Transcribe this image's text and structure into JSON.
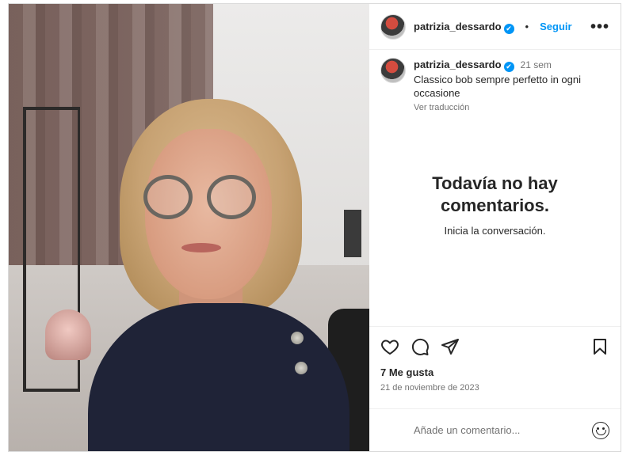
{
  "post": {
    "username": "patrizia_dessardo",
    "verified_symbol": "✔",
    "separator": "•",
    "follow_label": "Seguir",
    "more_label": "•••",
    "caption": {
      "username": "patrizia_dessardo",
      "time": "21 sem",
      "text": "Classico bob sempre perfetto in ogni occasione",
      "translate_label": "Ver traducción"
    },
    "empty_comments": {
      "title": "Todavía no hay comentarios.",
      "subtitle": "Inicia la conversación."
    },
    "actions": {
      "icons": [
        "heart-icon",
        "comment-icon",
        "share-icon",
        "bookmark-icon"
      ]
    },
    "likes": "7 Me gusta",
    "date": "21 de noviembre de 2023",
    "comment_input": {
      "placeholder": "Añade un comentario..."
    },
    "colors": {
      "accent": "#0095f6",
      "text": "#262626",
      "muted": "#737373",
      "border": "#dbdbdb"
    }
  }
}
